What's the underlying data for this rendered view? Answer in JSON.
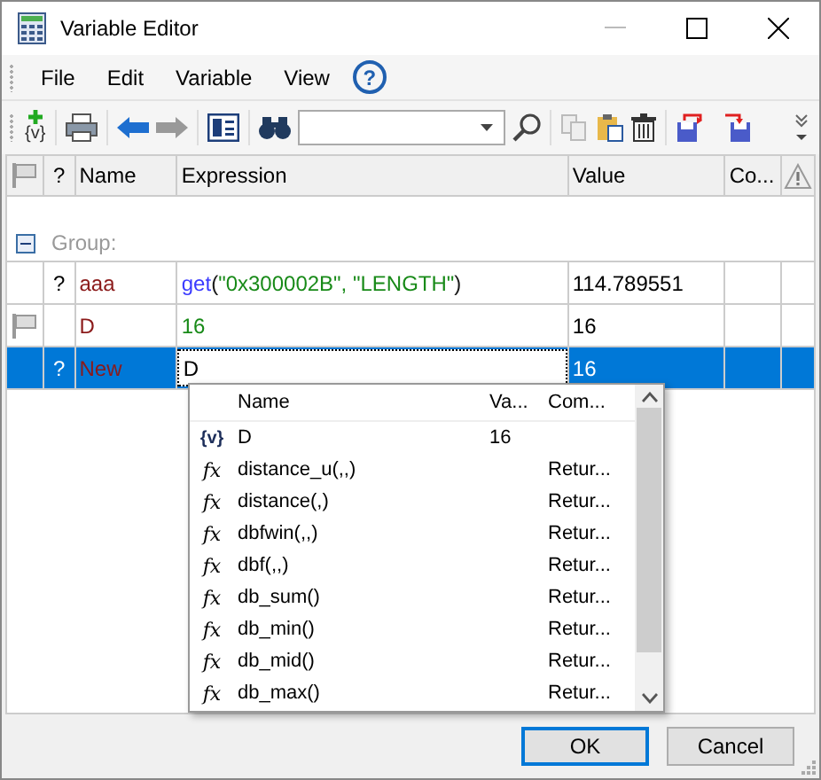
{
  "window": {
    "title": "Variable Editor"
  },
  "menu": {
    "items": [
      "File",
      "Edit",
      "Variable",
      "View"
    ],
    "help": "?"
  },
  "toolbar": {
    "new_variable_icon_text": "{v}"
  },
  "table": {
    "columns": [
      "?",
      "Name",
      "Expression",
      "Value",
      "Co..."
    ],
    "group": {
      "label": "Group:",
      "expanded": true
    },
    "rows": [
      {
        "flag": false,
        "question": "?",
        "name": "aaa",
        "expression": [
          {
            "kind": "func",
            "text": "get"
          },
          {
            "kind": "plain",
            "text": "("
          },
          {
            "kind": "string",
            "text": "\"0x300002B\", \"LENGTH\""
          },
          {
            "kind": "plain",
            "text": ")"
          }
        ],
        "value": "114.789551",
        "selected": false
      },
      {
        "flag": true,
        "name": "D",
        "expression": [
          {
            "kind": "string",
            "text": "16"
          }
        ],
        "value": "16",
        "selected": false
      },
      {
        "flag": false,
        "question": "?",
        "name": "New",
        "editing": "D",
        "value": "16",
        "selected": true
      }
    ]
  },
  "autocomplete": {
    "columns": [
      "Name",
      "Va...",
      "Com..."
    ],
    "items": [
      {
        "kind": "variable",
        "icon": "{v}",
        "name": "D",
        "value": "16"
      },
      {
        "kind": "function",
        "icon": "fx",
        "name": "distance_u(,,)",
        "comment": "Retur..."
      },
      {
        "kind": "function",
        "icon": "fx",
        "name": "distance(,)",
        "comment": "Retur..."
      },
      {
        "kind": "function",
        "icon": "fx",
        "name": "dbfwin(,,)",
        "comment": "Retur..."
      },
      {
        "kind": "function",
        "icon": "fx",
        "name": "dbf(,,)",
        "comment": "Retur..."
      },
      {
        "kind": "function",
        "icon": "fx",
        "name": "db_sum()",
        "comment": "Retur..."
      },
      {
        "kind": "function",
        "icon": "fx",
        "name": "db_min()",
        "comment": "Retur..."
      },
      {
        "kind": "function",
        "icon": "fx",
        "name": "db_mid()",
        "comment": "Retur..."
      },
      {
        "kind": "function",
        "icon": "fx",
        "name": "db_max()",
        "comment": "Retur..."
      }
    ]
  },
  "buttons": [
    {
      "label": "OK",
      "default": true
    },
    {
      "label": "Cancel",
      "default": false
    }
  ]
}
